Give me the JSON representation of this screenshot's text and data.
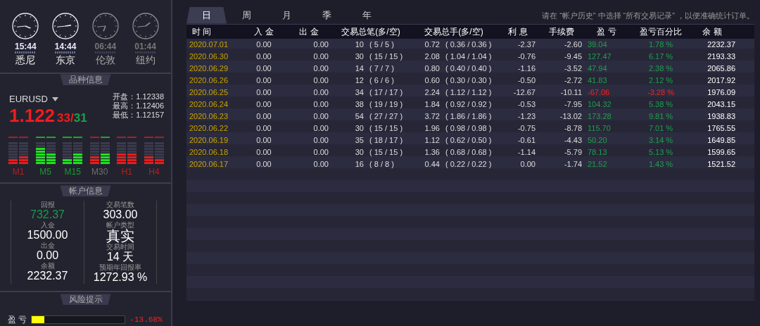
{
  "clocks": [
    {
      "time": "15:44",
      "city": "悉尼",
      "active": true
    },
    {
      "time": "14:44",
      "city": "东京",
      "active": true
    },
    {
      "time": "06:44",
      "city": "伦敦",
      "active": false
    },
    {
      "time": "01:44",
      "city": "纽约",
      "active": false
    }
  ],
  "symbol_panel": {
    "title": "品种信息",
    "symbol": "EURUSD",
    "price": "1.122",
    "bid_pips": "33",
    "separator": "/",
    "ask_pips": "31",
    "stats": [
      {
        "label": "开盘：",
        "value": "1.12338"
      },
      {
        "label": "最高：",
        "value": "1.12406"
      },
      {
        "label": "最低：",
        "value": "1.12157"
      }
    ],
    "meters": [
      {
        "label": "M1",
        "color": "#b02020",
        "bars": [
          {
            "color": "#e02020",
            "level": 0.25
          },
          {
            "color": "#e02020",
            "level": 0.375
          }
        ]
      },
      {
        "label": "M5",
        "color": "#1a9a2a",
        "bars": [
          {
            "color": "#20e020",
            "level": 0.75
          },
          {
            "color": "#20e020",
            "level": 0.5
          }
        ]
      },
      {
        "label": "M15",
        "color": "#1a9a2a",
        "bars": [
          {
            "color": "#20e020",
            "level": 0.25
          },
          {
            "color": "#20e020",
            "level": 0.5
          }
        ]
      },
      {
        "label": "M30",
        "color": "#707070",
        "bars": [
          {
            "color": "#e02020",
            "level": 0.375
          },
          {
            "color": "#20e020",
            "level": 0.5
          }
        ]
      },
      {
        "label": "H1",
        "color": "#b02020",
        "bars": [
          {
            "color": "#e02020",
            "level": 0.5
          },
          {
            "color": "#e02020",
            "level": 0.5
          }
        ]
      },
      {
        "label": "H4",
        "color": "#b02020",
        "bars": [
          {
            "color": "#e02020",
            "level": 0.375
          },
          {
            "color": "#e02020",
            "level": 0.25
          }
        ]
      }
    ]
  },
  "account_panel": {
    "title": "帐户信息",
    "items": [
      {
        "label": "回报",
        "value": "732.37",
        "color": "#1a9a4a"
      },
      {
        "label": "交易笔数",
        "value": "303.00",
        "color": "#ffffff"
      },
      {
        "label": "入金",
        "value": "1500.00",
        "color": "#ffffff"
      },
      {
        "label": "帐户类型",
        "value": "真实",
        "color": "#ffffff"
      },
      {
        "label": "出金",
        "value": "0.00",
        "color": "#ffffff"
      },
      {
        "label": "交易时间",
        "value": "14 天",
        "color": "#ffffff"
      },
      {
        "label": "余额",
        "value": "2232.37",
        "color": "#ffffff"
      },
      {
        "label": "预期年回报率",
        "value": "1272.93 %",
        "color": "#ffffff"
      }
    ]
  },
  "risk_panel": {
    "title": "风险提示",
    "label": "盈 亏",
    "level": 0.135,
    "reading": "-13.68%"
  },
  "tabs": [
    {
      "label": "日",
      "selected": true
    },
    {
      "label": "周",
      "selected": false
    },
    {
      "label": "月",
      "selected": false
    },
    {
      "label": "季",
      "selected": false
    },
    {
      "label": "年",
      "selected": false
    }
  ],
  "notice": "请在 “帐户历史” 中选择 “所有交易记录” ，以便准确统计订单。",
  "table": {
    "columns": [
      "时 间",
      "入 金",
      "出 金",
      "交易总笔(多/空)",
      "交易总手(多/空)",
      "利 息",
      "手续费",
      "盈 亏",
      "盈亏百分比",
      "余 额"
    ],
    "rows": [
      {
        "date": "2020.07.01",
        "deposit": "0.00",
        "withdraw": "0.00",
        "trades": "10",
        "trades_split": "( 5 / 5 )",
        "lots": "0.72",
        "lots_split": "( 0.36 / 0.36 )",
        "interest": "-2.37",
        "fee": "-2.60",
        "profit": "39.04",
        "percent": "1.78 %",
        "balance": "2232.37",
        "loss": false
      },
      {
        "date": "2020.06.30",
        "deposit": "0.00",
        "withdraw": "0.00",
        "trades": "30",
        "trades_split": "( 15 / 15 )",
        "lots": "2.08",
        "lots_split": "( 1.04 / 1.04 )",
        "interest": "-0.76",
        "fee": "-9.45",
        "profit": "127.47",
        "percent": "6.17 %",
        "balance": "2193.33",
        "loss": false
      },
      {
        "date": "2020.06.29",
        "deposit": "0.00",
        "withdraw": "0.00",
        "trades": "14",
        "trades_split": "( 7 / 7 )",
        "lots": "0.80",
        "lots_split": "( 0.40 / 0.40 )",
        "interest": "-1.16",
        "fee": "-3.52",
        "profit": "47.94",
        "percent": "2.38 %",
        "balance": "2065.86",
        "loss": false
      },
      {
        "date": "2020.06.26",
        "deposit": "0.00",
        "withdraw": "0.00",
        "trades": "12",
        "trades_split": "( 6 / 6 )",
        "lots": "0.60",
        "lots_split": "( 0.30 / 0.30 )",
        "interest": "-0.50",
        "fee": "-2.72",
        "profit": "41.83",
        "percent": "2.12 %",
        "balance": "2017.92",
        "loss": false
      },
      {
        "date": "2020.06.25",
        "deposit": "0.00",
        "withdraw": "0.00",
        "trades": "34",
        "trades_split": "( 17 / 17 )",
        "lots": "2.24",
        "lots_split": "( 1.12 / 1.12 )",
        "interest": "-12.67",
        "fee": "-10.11",
        "profit": "-67.06",
        "percent": "-3.28 %",
        "balance": "1976.09",
        "loss": true
      },
      {
        "date": "2020.06.24",
        "deposit": "0.00",
        "withdraw": "0.00",
        "trades": "38",
        "trades_split": "( 19 / 19 )",
        "lots": "1.84",
        "lots_split": "( 0.92 / 0.92 )",
        "interest": "-0.53",
        "fee": "-7.95",
        "profit": "104.32",
        "percent": "5.38 %",
        "balance": "2043.15",
        "loss": false
      },
      {
        "date": "2020.06.23",
        "deposit": "0.00",
        "withdraw": "0.00",
        "trades": "54",
        "trades_split": "( 27 / 27 )",
        "lots": "3.72",
        "lots_split": "( 1.86 / 1.86 )",
        "interest": "-1.23",
        "fee": "-13.02",
        "profit": "173.28",
        "percent": "9.81 %",
        "balance": "1938.83",
        "loss": false
      },
      {
        "date": "2020.06.22",
        "deposit": "0.00",
        "withdraw": "0.00",
        "trades": "30",
        "trades_split": "( 15 / 15 )",
        "lots": "1.96",
        "lots_split": "( 0.98 / 0.98 )",
        "interest": "-0.75",
        "fee": "-8.78",
        "profit": "115.70",
        "percent": "7.01 %",
        "balance": "1765.55",
        "loss": false
      },
      {
        "date": "2020.06.19",
        "deposit": "0.00",
        "withdraw": "0.00",
        "trades": "35",
        "trades_split": "( 18 / 17 )",
        "lots": "1.12",
        "lots_split": "( 0.62 / 0.50 )",
        "interest": "-0.61",
        "fee": "-4.43",
        "profit": "50.20",
        "percent": "3.14 %",
        "balance": "1649.85",
        "loss": false
      },
      {
        "date": "2020.06.18",
        "deposit": "0.00",
        "withdraw": "0.00",
        "trades": "30",
        "trades_split": "( 15 / 15 )",
        "lots": "1.36",
        "lots_split": "( 0.68 / 0.68 )",
        "interest": "-1.14",
        "fee": "-5.79",
        "profit": "78.13",
        "percent": "5.13 %",
        "balance": "1599.65",
        "loss": false
      },
      {
        "date": "2020.06.17",
        "deposit": "0.00",
        "withdraw": "0.00",
        "trades": "16",
        "trades_split": "( 8 / 8 )",
        "lots": "0.44",
        "lots_split": "( 0.22 / 0.22 )",
        "interest": "0.00",
        "fee": "-1.74",
        "profit": "21.52",
        "percent": "1.43 %",
        "balance": "1521.52",
        "loss": false
      }
    ]
  }
}
